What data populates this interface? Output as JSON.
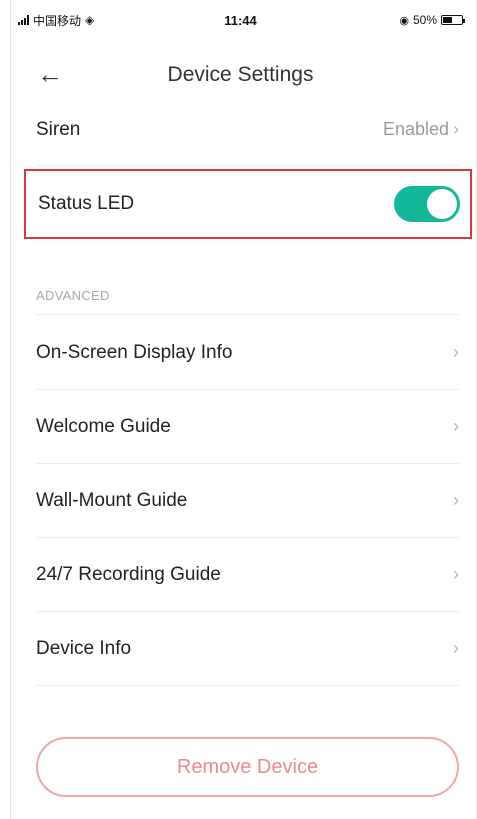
{
  "status_bar": {
    "carrier": "中国移动",
    "time": "11:44",
    "battery_text": "50%",
    "battery_level": 0.5
  },
  "header": {
    "title": "Device Settings"
  },
  "siren": {
    "label": "Siren",
    "value": "Enabled"
  },
  "status_led": {
    "label": "Status LED",
    "enabled": true,
    "toggle_color": "#15b79a",
    "highlight_color": "#d43a3a"
  },
  "advanced": {
    "section_label": "ADVANCED",
    "items": [
      {
        "label": "On-Screen Display Info"
      },
      {
        "label": "Welcome Guide"
      },
      {
        "label": "Wall-Mount Guide"
      },
      {
        "label": "24/7 Recording Guide"
      },
      {
        "label": "Device Info"
      }
    ]
  },
  "remove_button": {
    "label": "Remove Device",
    "color": "#ef8a8a"
  }
}
